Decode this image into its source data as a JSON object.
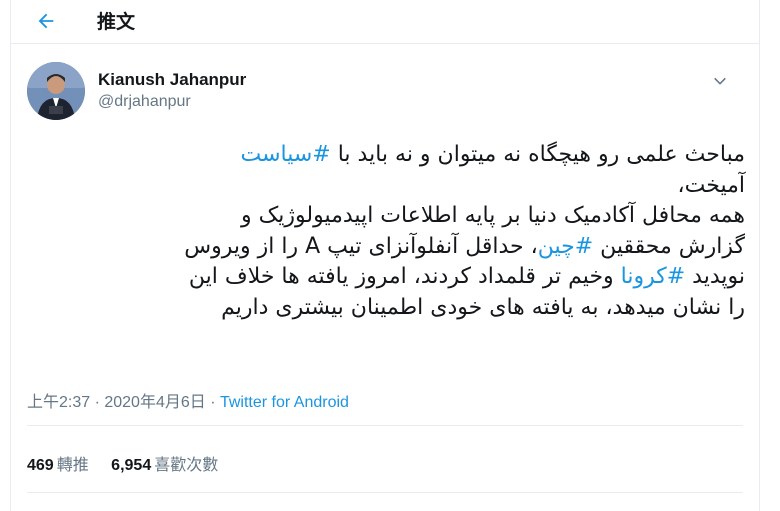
{
  "header": {
    "title": "推文",
    "back_icon": "arrow-left-icon"
  },
  "accent_color": "#1b95e0",
  "tweet": {
    "author_name": "Kianush Jahanpur",
    "author_handle": "@drjahanpur",
    "lines": [
      [
        {
          "text": "مباحث علمی رو هیچگاه نه میتوان و نه باید با "
        },
        {
          "text": "#سیاست",
          "hashtag": true
        }
      ],
      [
        {
          "text": "آمیخت،"
        }
      ],
      [
        {
          "text": "همه محافل آکادمیک دنیا بر پایه اطلاعات اپیدمیولوژیک و"
        }
      ],
      [
        {
          "text": "گزارش محققین "
        },
        {
          "text": "#چین",
          "hashtag": true
        },
        {
          "text": "، حداقل آنفلوآنزای تیپ A را از ویروس"
        }
      ],
      [
        {
          "text": "نوپدید "
        },
        {
          "text": "#کرونا",
          "hashtag": true
        },
        {
          "text": " وخیم تر قلمداد کردند، امروز یافته ها خلاف این"
        }
      ],
      [
        {
          "text": "را نشان میدهد، به یافته های خودی اطمینان بیشتری داریم"
        }
      ]
    ],
    "timestamp": "上午2:37 · 2020年4月6日 · ",
    "source": "Twitter for Android"
  },
  "stats": {
    "retweets_count": "469",
    "retweets_label": "轉推",
    "likes_count": "6,954",
    "likes_label": "喜歡次數"
  }
}
